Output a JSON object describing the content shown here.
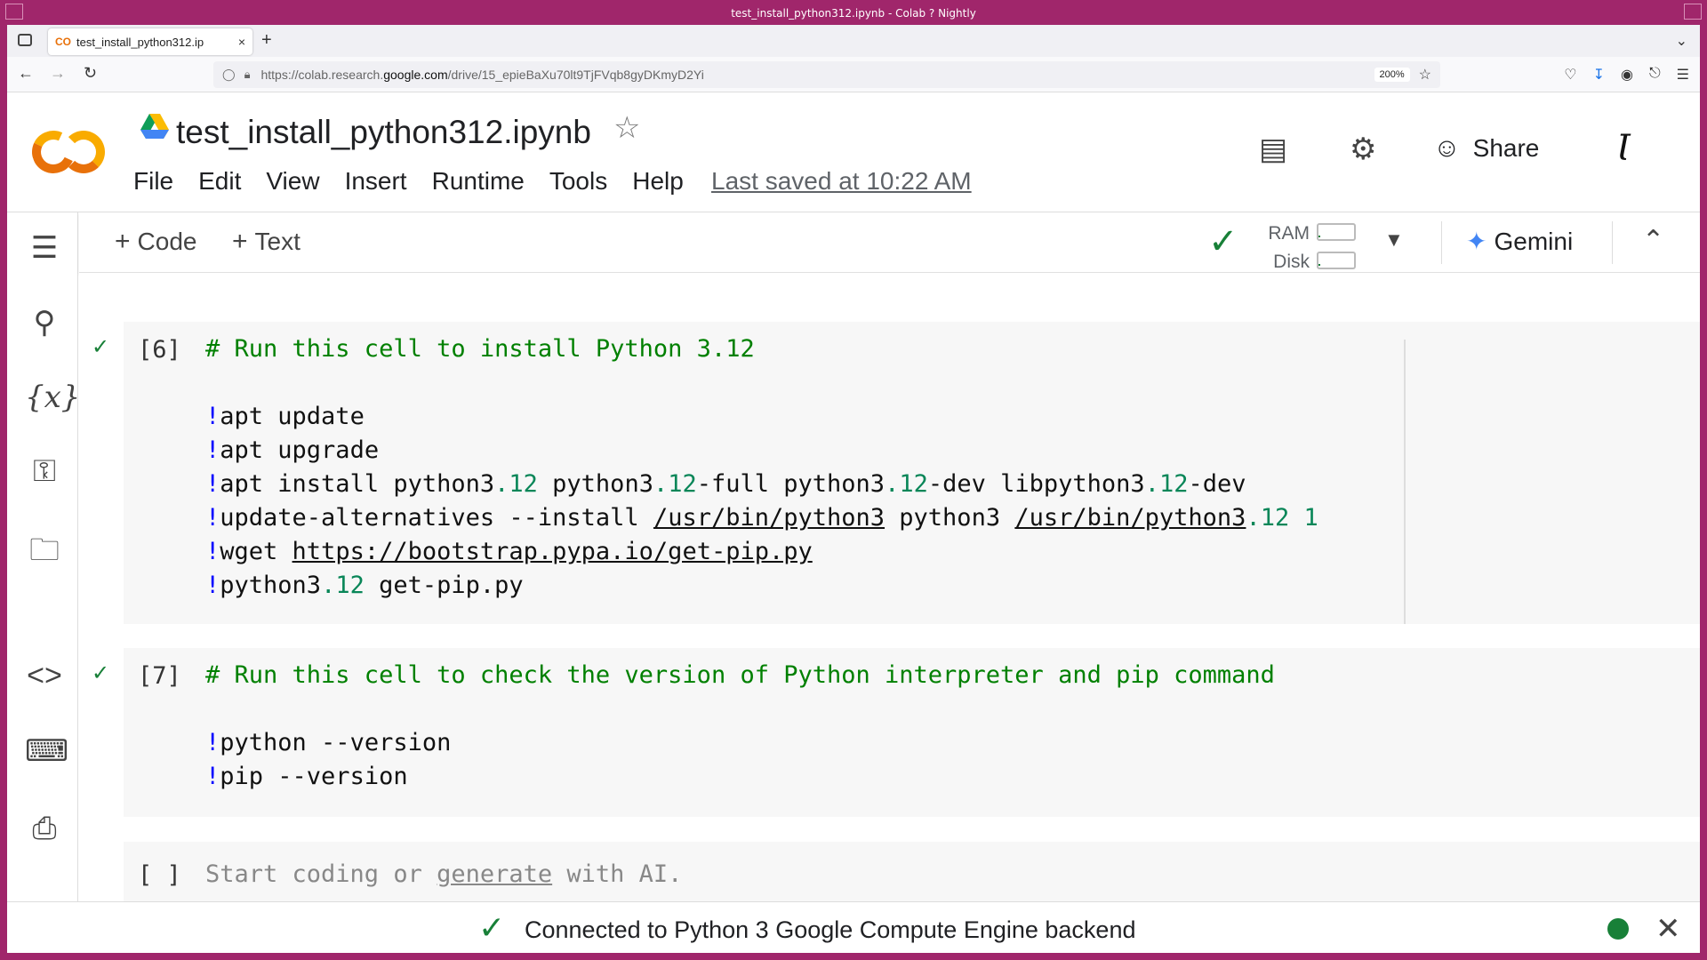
{
  "window": {
    "title": "test_install_python312.ipynb - Colab ? Nightly"
  },
  "browser": {
    "tab_title": "test_install_python312.ip",
    "tab_favicon": "CO",
    "tab_close": "×",
    "new_tab": "+",
    "url_prefix": "https://colab.research.",
    "url_host": "google.com",
    "url_path": "/drive/15_epieBaXu70lt9TjFVqb8gyDKmyD2Yi",
    "zoom": "200%"
  },
  "header": {
    "title": "test_install_python312.ipynb",
    "menu": [
      "File",
      "Edit",
      "View",
      "Insert",
      "Runtime",
      "Tools",
      "Help"
    ],
    "last_saved": "Last saved at 10:22 AM",
    "share_label": "Share"
  },
  "toolbar": {
    "add_code": "Code",
    "add_text": "Text",
    "ram_label": "RAM",
    "disk_label": "Disk",
    "gemini_label": "Gemini",
    "ram_usage": 0.05,
    "disk_usage": 0.05
  },
  "cells": [
    {
      "count": "[6]",
      "status": "ran",
      "lines": [
        "# Run this cell to install Python 3.12",
        "",
        "!apt update",
        "!apt upgrade",
        "!apt install python3.12 python3.12-full python3.12-dev libpython3.12-dev",
        "!update-alternatives --install /usr/bin/python3 python3 /usr/bin/python3.12 1",
        "!wget https://bootstrap.pypa.io/get-pip.py",
        "!python3.12 get-pip.py"
      ]
    },
    {
      "count": "[7]",
      "status": "ran",
      "lines": [
        "# Run this cell to check the version of Python interpreter and pip command",
        "",
        "!python --version",
        "!pip --version"
      ]
    },
    {
      "count": "[ ]",
      "status": "empty",
      "placeholder_before": "Start coding or ",
      "placeholder_link": "generate",
      "placeholder_after": " with AI."
    }
  ],
  "status": {
    "text": "Connected to Python 3 Google Compute Engine backend"
  },
  "colors": {
    "accent_green": "#188038",
    "frame": "#a0266b",
    "colab_orange": "#f9ab00"
  }
}
